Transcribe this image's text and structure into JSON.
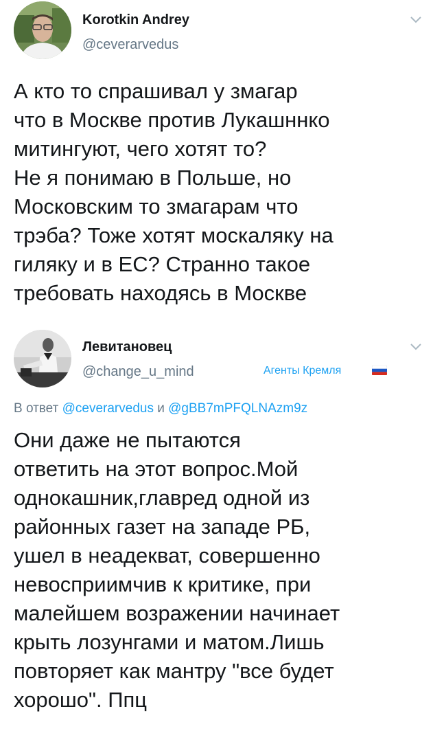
{
  "tweet1": {
    "name": "Korotkin Andrey",
    "handle": "@ceverarvedus",
    "text": "А кто то спрашивал у змагар\nчто в Москве против Лукашннко\nмитингуют,  чего хотят то?\nНе я понимаю в Польше, но\nМосковским то змагарам что\nтрэба? Тоже хотят москаляку на\nгиляку и в ЕС? Странно такое\nтребовать находясь в Москве",
    "icons": {
      "avatar": "user-photo",
      "menu": "chevron-down-icon"
    }
  },
  "tweet2": {
    "name": "Левитановец",
    "handle": "@change_u_mind",
    "label": "Агенты Кремля",
    "reply_prefix": "В ответ",
    "reply_user1": "@ceverarvedus",
    "reply_and": "и",
    "reply_user2": "@gBB7mPFQLNAzm9z",
    "text": "Они даже не пытаются\nответить на этот вопрос.Мой\nоднокашник,главред одной из\nрайонных газет на западе РБ,\nушел в неадекват, совершенно\nневосприимчив к критике, при\nмалейшем возражении начинает\nкрыть лозунгами и матом.Лишь\nповторяет как мантру \"все будет\nхорошо\". Ппц",
    "icons": {
      "avatar": "user-photo",
      "menu": "chevron-down-icon",
      "flag": "russia-flag-icon"
    }
  },
  "colors": {
    "text": "#14171a",
    "secondary": "#657786",
    "link": "#1da1f2"
  }
}
